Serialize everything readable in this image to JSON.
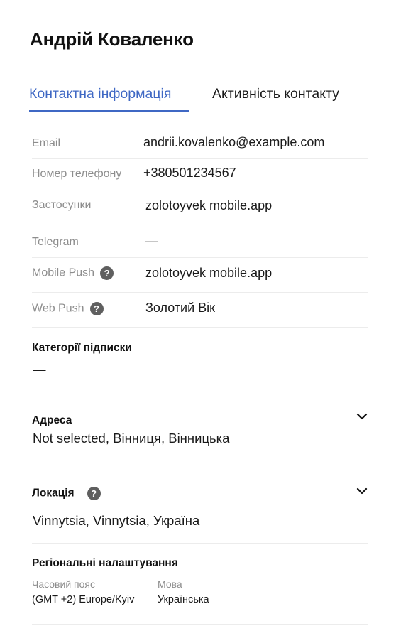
{
  "contact": {
    "name": "Андрій Коваленко"
  },
  "tabs": [
    {
      "label": "Контактна інформація",
      "active": true
    },
    {
      "label": "Активність контакту",
      "active": false
    }
  ],
  "fields": {
    "email": {
      "label": "Email",
      "value": "andrii.kovalenko@example.com"
    },
    "phone": {
      "label": "Номер телефону",
      "value": "+380501234567"
    },
    "apps": {
      "label": "Застосунки",
      "value": "zolotoyvek mobile.app"
    },
    "telegram": {
      "label": "Telegram",
      "value": "—"
    },
    "mobile_push": {
      "label": "Mobile Push",
      "value": "zolotoyvek mobile.app",
      "icon": "help-icon"
    },
    "web_push": {
      "label": "Web Push",
      "value": "Золотий Вік",
      "icon": "help-icon"
    }
  },
  "subscription_categories": {
    "title": "Категорії підписки",
    "value": "—"
  },
  "address": {
    "title": "Адреса",
    "value": "Not selected, Вінниця, Вінницька",
    "icon": "chevron-down-icon"
  },
  "location": {
    "title": "Локація",
    "value": "Vinnytsia, Vinnytsia, Україна",
    "icons": [
      "help-icon",
      "chevron-down-icon"
    ]
  },
  "regional": {
    "title": "Регіональні налаштування",
    "timezone_label": "Часовий пояс",
    "timezone_value": "(GMT +2) Europe/Kyiv",
    "language_label": "Мова",
    "language_value": "Українська"
  },
  "colors": {
    "accent": "#3f68c4",
    "label": "#8d8d8d",
    "icon": "#5f5f5f"
  }
}
